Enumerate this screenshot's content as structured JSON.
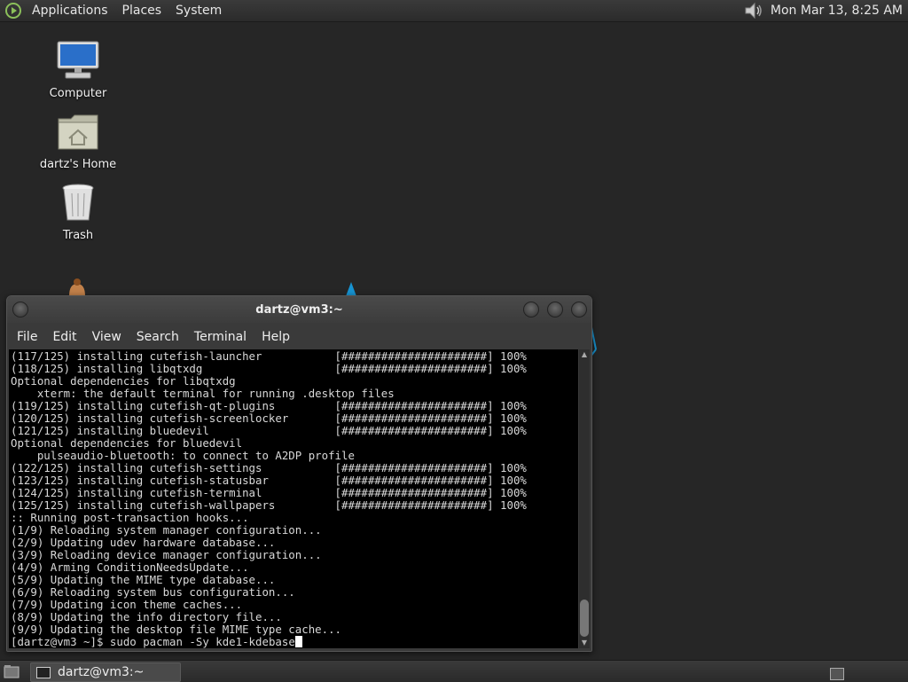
{
  "top_panel": {
    "menus": [
      "Applications",
      "Places",
      "System"
    ],
    "clock": "Mon Mar 13,  8:25 AM",
    "icons": {
      "logo": "distro-logo-icon",
      "volume": "volume-icon"
    }
  },
  "desktop": {
    "icons": [
      {
        "label": "Computer",
        "icon": "computer-icon"
      },
      {
        "label": "dartz's Home",
        "icon": "home-folder-icon"
      },
      {
        "label": "Trash",
        "icon": "trash-icon"
      }
    ]
  },
  "window": {
    "title": "dartz@vm3:~",
    "menus": [
      "File",
      "Edit",
      "View",
      "Search",
      "Terminal",
      "Help"
    ],
    "lines": [
      "(117/125) installing cutefish-launcher           [######################] 100%",
      "(118/125) installing libqtxdg                    [######################] 100%",
      "Optional dependencies for libqtxdg",
      "    xterm: the default terminal for running .desktop files",
      "(119/125) installing cutefish-qt-plugins         [######################] 100%",
      "(120/125) installing cutefish-screenlocker       [######################] 100%",
      "(121/125) installing bluedevil                   [######################] 100%",
      "Optional dependencies for bluedevil",
      "    pulseaudio-bluetooth: to connect to A2DP profile",
      "(122/125) installing cutefish-settings           [######################] 100%",
      "(123/125) installing cutefish-statusbar          [######################] 100%",
      "(124/125) installing cutefish-terminal           [######################] 100%",
      "(125/125) installing cutefish-wallpapers         [######################] 100%",
      ":: Running post-transaction hooks...",
      "(1/9) Reloading system manager configuration...",
      "(2/9) Updating udev hardware database...",
      "(3/9) Reloading device manager configuration...",
      "(4/9) Arming ConditionNeedsUpdate...",
      "(5/9) Updating the MIME type database...",
      "(6/9) Reloading system bus configuration...",
      "(7/9) Updating icon theme caches...",
      "(8/9) Updating the info directory file...",
      "(9/9) Updating the desktop file MIME type cache..."
    ],
    "prompt": "[dartz@vm3 ~]$ ",
    "command": "sudo pacman -Sy kde1-kdebase"
  },
  "bottom_panel": {
    "task_label": "dartz@vm3:~"
  },
  "colors": {
    "desktop_bg": "#262626",
    "terminal_bg": "#000000",
    "terminal_fg": "#d8d8d8"
  }
}
